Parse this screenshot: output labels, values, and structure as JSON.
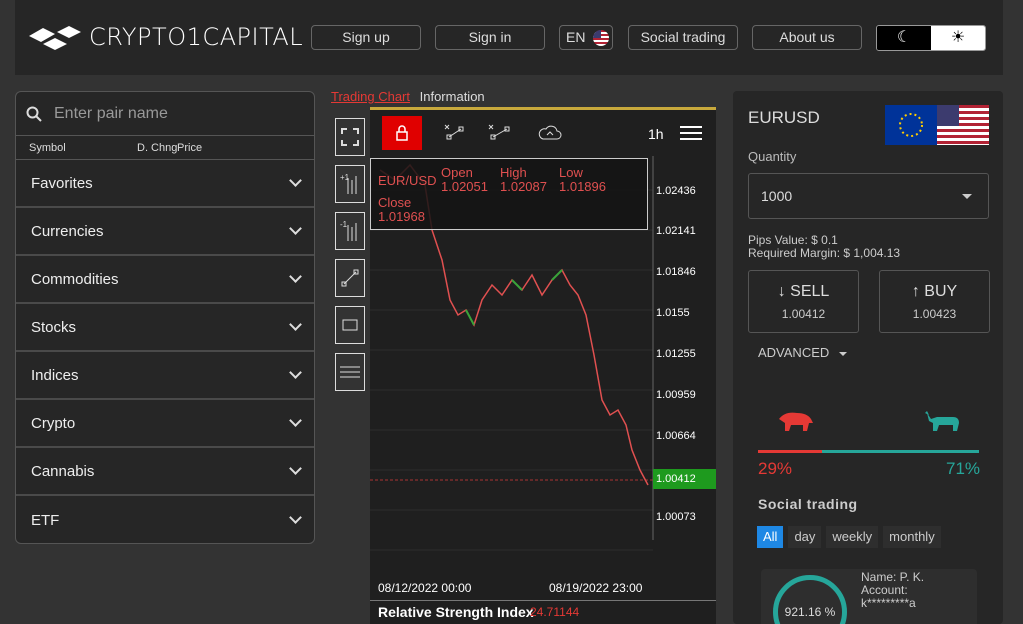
{
  "header": {
    "brand": "CRYPTO1CAPITAL",
    "nav": [
      "Sign up",
      "Sign in",
      "EN",
      "Social trading",
      "About us"
    ]
  },
  "sidebar": {
    "search_placeholder": "Enter pair name",
    "columns": [
      "Symbol",
      "D. Chng",
      "Price"
    ],
    "categories": [
      "Favorites",
      "Currencies",
      "Commodities",
      "Stocks",
      "Indices",
      "Crypto",
      "Cannabis",
      "ETF"
    ]
  },
  "chart_tabs": {
    "active": "Trading Chart",
    "other": "Information"
  },
  "chart": {
    "timeframe": "1h",
    "ohlc": {
      "symbol": "EUR/USD",
      "open_label": "Open",
      "open": "1.02051",
      "high_label": "High",
      "high": "1.02087",
      "low_label": "Low",
      "low": "1.01896",
      "close_label": "Close",
      "close": "1.01968"
    },
    "price_labels": [
      "1.02436",
      "1.02141",
      "1.01846",
      "1.0155",
      "1.01255",
      "1.00959",
      "1.00664",
      "1.00073"
    ],
    "current_price": "1.00412",
    "dates": [
      "08/12/2022 00:00",
      "08/19/2022 23:00"
    ],
    "rsi_label": "Relative Strength Index",
    "rsi_value": "24.71144"
  },
  "trade": {
    "pair": "EURUSD",
    "quantity_label": "Quantity",
    "quantity": "1000",
    "pips_value": "Pips Value: $ 0.1",
    "required_margin": "Required Margin: $ 1,004.13",
    "sell_label": "SELL",
    "sell_price": "1.00412",
    "buy_label": "BUY",
    "buy_price": "1.00423",
    "advanced_label": "ADVANCED",
    "sentiment_bear": "29%",
    "sentiment_bull": "71%",
    "bear_fraction": 0.29,
    "social_title": "Social trading",
    "periods": [
      "All",
      "day",
      "weekly",
      "monthly"
    ],
    "trader": {
      "percent": "921.16 %",
      "name": "Name: P. K.",
      "account_label": "Account:",
      "account": "k*********a"
    }
  },
  "colors": {
    "accent_red": "#e53935",
    "accent_green": "#26a69a",
    "buy_tab_blue": "#1e88e5"
  }
}
